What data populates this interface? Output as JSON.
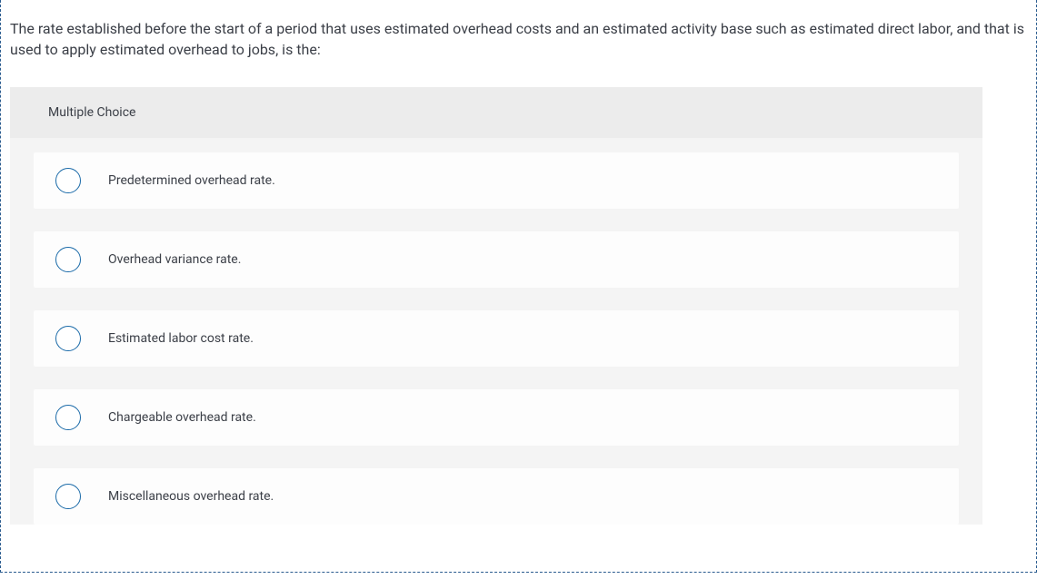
{
  "question": {
    "prompt": "The rate established before the start of a period that uses estimated overhead costs and an estimated activity base such as estimated direct labor, and that is used to apply estimated overhead to jobs, is the:",
    "type_label": "Multiple Choice",
    "options": [
      {
        "label": "Predetermined overhead rate."
      },
      {
        "label": "Overhead variance rate."
      },
      {
        "label": "Estimated labor cost rate."
      },
      {
        "label": "Chargeable overhead rate."
      },
      {
        "label": "Miscellaneous overhead rate."
      }
    ]
  }
}
